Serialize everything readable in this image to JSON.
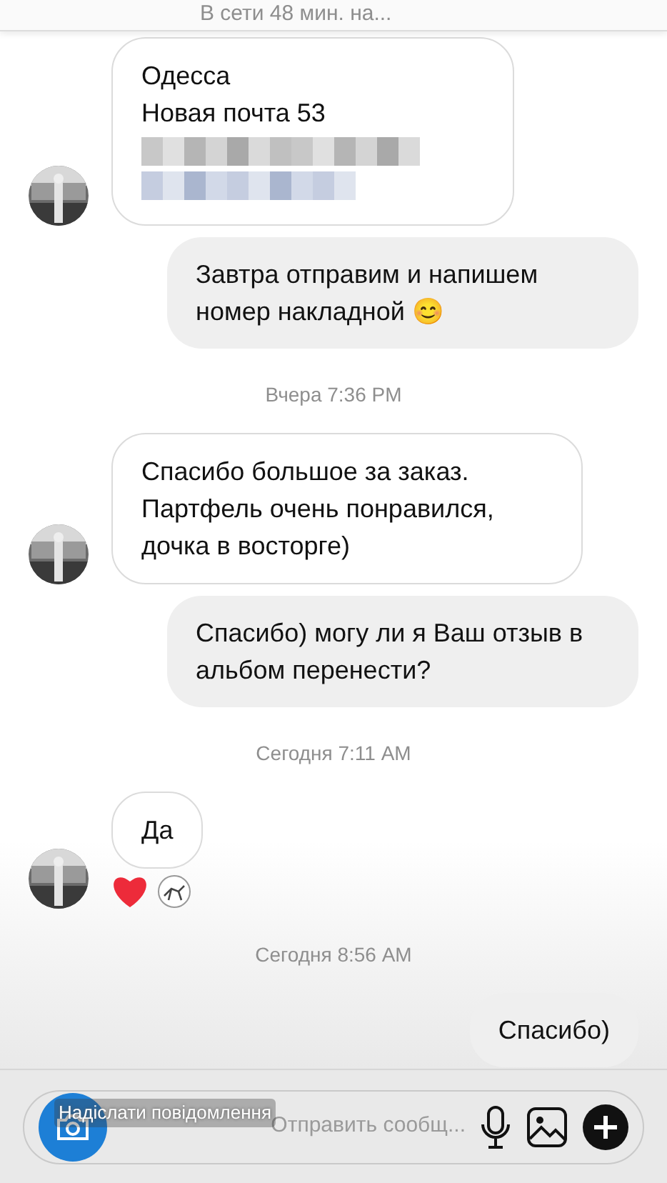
{
  "header": {
    "status": "В сети 48 мин. на..."
  },
  "messages": [
    {
      "kind": "incoming",
      "text": "Одесса\nНовая почта 53",
      "blurred": true,
      "avatar": true
    },
    {
      "kind": "outgoing",
      "text": "Завтра отправим и напишем номер накладной 😊"
    },
    {
      "kind": "timestamp",
      "text": "Вчера 7:36 PM"
    },
    {
      "kind": "incoming",
      "text": "Спасибо большое за заказ. Партфель очень понравился, дочка в восторге)",
      "blurred": false,
      "avatar": true
    },
    {
      "kind": "outgoing",
      "text": "Спасибо) могу ли я Ваш отзыв в альбом перенести?"
    },
    {
      "kind": "timestamp",
      "text": "Сегодня 7:11 AM"
    },
    {
      "kind": "incoming",
      "text": "Да",
      "blurred": false,
      "avatar": true,
      "reactions": [
        {
          "kind": "heart"
        },
        {
          "kind": "avatar"
        }
      ]
    },
    {
      "kind": "timestamp",
      "text": "Сегодня 8:56 AM"
    },
    {
      "kind": "outgoing",
      "text": "Спасибо)"
    }
  ],
  "composer": {
    "placeholder": "Отправить сообщ...",
    "overlay_label": "Надіслати повідомлення"
  }
}
